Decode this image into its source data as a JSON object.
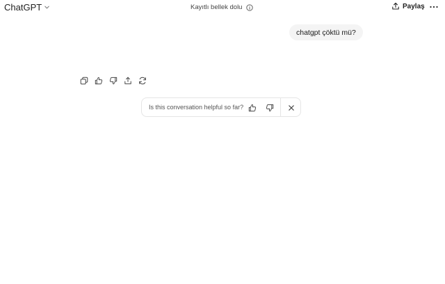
{
  "header": {
    "title": "ChatGPT",
    "memory_status": "Kayıtlı bellek dolu",
    "share_label": "Paylaş"
  },
  "conversation": {
    "user_message": "chatgpt çöktü mü?"
  },
  "feedback": {
    "question": "Is this conversation helpful so far?"
  },
  "icons": {
    "model_chevron": "chevron-down-icon",
    "memory_info": "info-icon",
    "share": "share-icon",
    "more": "more-horizontal-icon",
    "copy": "copy-icon",
    "thumbs_up": "thumbs-up-icon",
    "thumbs_down": "thumbs-down-icon",
    "upload": "share-upload-icon",
    "regenerate": "regenerate-icon",
    "close": "close-icon"
  },
  "colors": {
    "bubble_bg": "#f4f4f4",
    "border": "#e5e5e5",
    "text": "#0d0d0d",
    "muted": "#555555"
  }
}
